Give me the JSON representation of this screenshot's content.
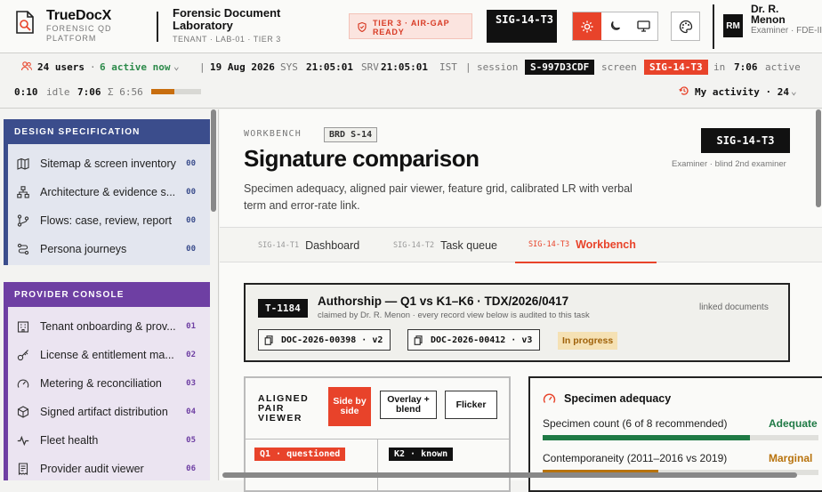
{
  "brand": {
    "name": "TrueDocX",
    "sub": "FORENSIC QD PLATFORM"
  },
  "lab": {
    "title": "Forensic Document Laboratory",
    "sub": "TENANT · LAB-01 · TIER 3"
  },
  "tier_badge": "TIER 3 · AIR-GAP READY",
  "screen_chip": "SIG-14-T3",
  "user": {
    "initials": "RM",
    "name": "Dr. R. Menon",
    "role": "Examiner · FDE-II"
  },
  "status": {
    "users": "24 users",
    "active": "6 active now",
    "date": "19 Aug 2026",
    "sys_label": "SYS",
    "sys_time": "21:05:01",
    "srv_label": "SRV",
    "srv_time": "21:05:01",
    "tz": "IST",
    "session_label": "session",
    "session_id": "S-997D3CDF",
    "screen_label": "screen",
    "screen_id": "SIG-14-T3",
    "in_label": "in",
    "in_time": "7:06",
    "active_label": "active",
    "active_time": "0:10",
    "idle_label": "idle",
    "idle_time": "7:06",
    "sum_label": "Σ 6:56",
    "idle_fraction": 0.47,
    "my_activity": "My activity · 24"
  },
  "sidebar": {
    "sections": [
      {
        "title": "DESIGN SPECIFICATION",
        "color": "#3b4d8c",
        "items": [
          {
            "label": "Sitemap & screen inventory",
            "num": "00",
            "icon": "map-icon"
          },
          {
            "label": "Architecture & evidence s...",
            "num": "00",
            "icon": "architecture-icon"
          },
          {
            "label": "Flows: case, review, report",
            "num": "00",
            "icon": "flow-icon"
          },
          {
            "label": "Persona journeys",
            "num": "00",
            "icon": "journey-icon"
          }
        ]
      },
      {
        "title": "PROVIDER CONSOLE",
        "color": "#6e3fa3",
        "items": [
          {
            "label": "Tenant onboarding & prov...",
            "num": "01",
            "icon": "building-icon"
          },
          {
            "label": "License & entitlement ma...",
            "num": "02",
            "icon": "key-icon"
          },
          {
            "label": "Metering & reconciliation",
            "num": "03",
            "icon": "gauge-icon"
          },
          {
            "label": "Signed artifact distribution",
            "num": "04",
            "icon": "package-icon"
          },
          {
            "label": "Fleet health",
            "num": "05",
            "icon": "pulse-icon"
          },
          {
            "label": "Provider audit viewer",
            "num": "06",
            "icon": "receipt-icon"
          }
        ]
      }
    ]
  },
  "main": {
    "workbench_label": "WORKBENCH",
    "brd": "BRD S-14",
    "title": "Signature comparison",
    "description": "Specimen adequacy, aligned pair viewer, feature grid, calibrated LR with verbal term and error-rate link.",
    "screen_chip": "SIG-14-T3",
    "examiner_note": "Examiner · blind 2nd examiner",
    "tabs": [
      {
        "code": "SIG-14-T1",
        "label": "Dashboard"
      },
      {
        "code": "SIG-14-T2",
        "label": "Task queue"
      },
      {
        "code": "SIG-14-T3",
        "label": "Workbench"
      }
    ],
    "task": {
      "id": "T-1184",
      "title": "Authorship — Q1 vs K1–K6 · TDX/2026/0417",
      "sub": "claimed by Dr. R. Menon · every record view below is audited to this task",
      "linked_label": "linked documents",
      "docs": [
        "DOC-2026-00398 · v2",
        "DOC-2026-00412 · v3"
      ],
      "status": "In progress"
    },
    "viewer": {
      "title": "ALIGNED PAIR VIEWER",
      "modes": [
        "Side by side",
        "Overlay + blend",
        "Flicker"
      ],
      "left_chip": "Q1 · questioned",
      "right_chip": "K2 · known"
    },
    "adequacy": {
      "title": "Specimen adequacy",
      "rows": [
        {
          "label": "Specimen count (6 of 8 recommended)",
          "status": "Adequate",
          "color": "#1f7a45",
          "fraction": 0.75
        },
        {
          "label": "Contemporaneity (2011–2016 vs 2019)",
          "status": "Marginal",
          "color": "#b8730d",
          "fraction": 0.42
        }
      ]
    }
  }
}
